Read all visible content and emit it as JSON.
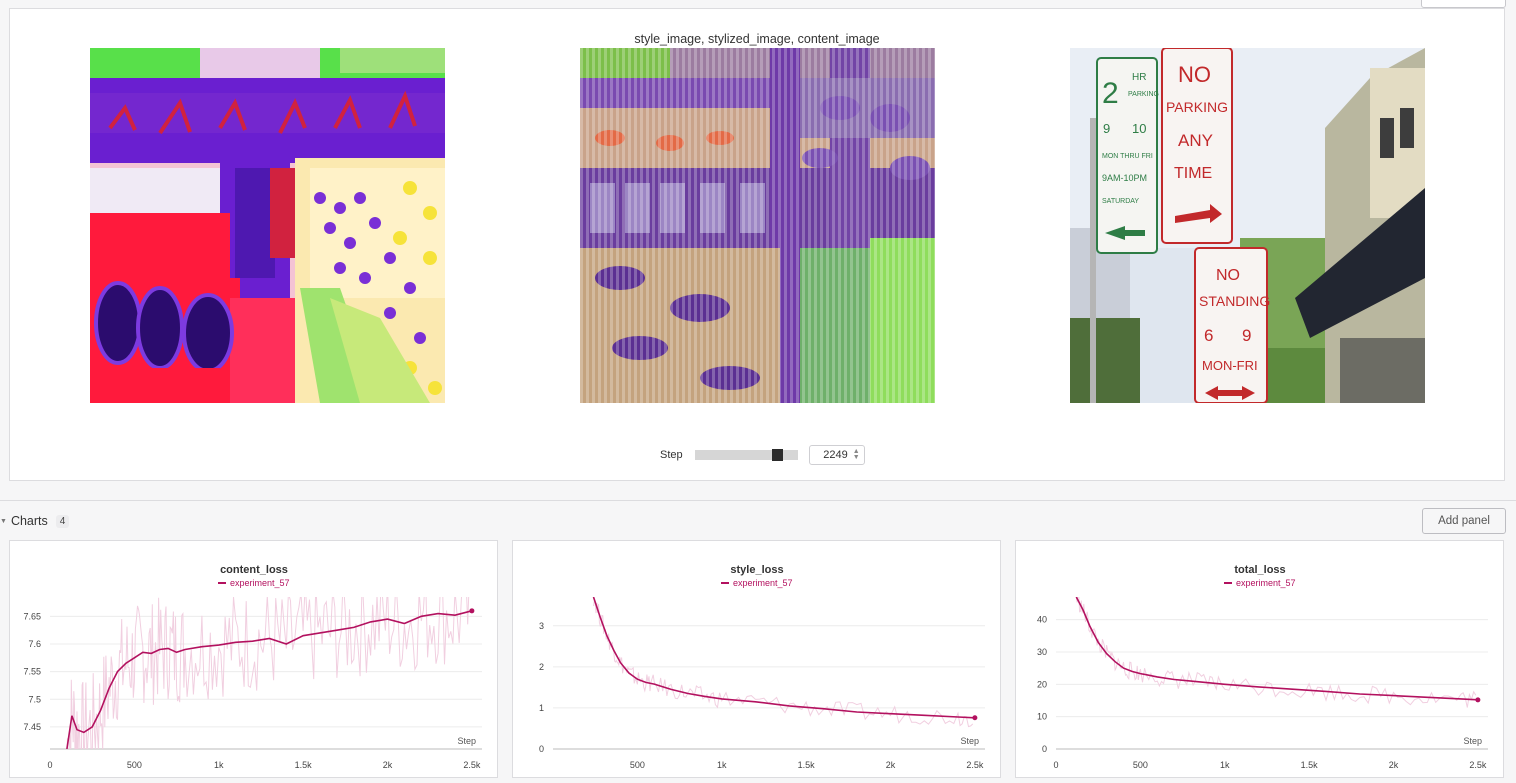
{
  "media": {
    "title": "style_image, stylized_image, content_image",
    "images": [
      {
        "name": "style_image"
      },
      {
        "name": "stylized_image"
      },
      {
        "name": "content_image",
        "sign_texts": [
          "2",
          "HR",
          "PARKING",
          "9",
          "10",
          "MON THRU FRI",
          "9AM-10PM",
          "SATURDAY",
          "NO",
          "PARKING",
          "ANY",
          "TIME",
          "NO",
          "STANDING",
          "6",
          "9",
          "MON-FRI"
        ]
      }
    ],
    "step": {
      "label": "Step",
      "value": "2249",
      "position_fraction": 0.84
    }
  },
  "charts_section": {
    "title": "Charts",
    "count": "4",
    "add_panel_label": "Add panel"
  },
  "colors": {
    "series": "#b3115f",
    "series_light": "#f1cfe0",
    "grid": "#ececec"
  },
  "charts": [
    {
      "title": "content_loss",
      "legend": "experiment_57",
      "xlabel": "Step",
      "xticks": [
        "0",
        "500",
        "1k",
        "1.5k",
        "2k",
        "2.5k"
      ],
      "yticks": [
        "7.45",
        "7.5",
        "7.55",
        "7.6",
        "7.65"
      ],
      "chart_data": {
        "type": "line",
        "series": [
          {
            "name": "experiment_57",
            "x": [
              100,
              130,
              160,
              200,
              250,
              300,
              350,
              400,
              450,
              500,
              550,
              600,
              650,
              700,
              750,
              800,
              900,
              1000,
              1100,
              1200,
              1300,
              1400,
              1500,
              1600,
              1700,
              1800,
              1900,
              2000,
              2100,
              2200,
              2300,
              2400,
              2500
            ],
            "y": [
              7.41,
              7.47,
              7.445,
              7.44,
              7.45,
              7.48,
              7.52,
              7.55,
              7.565,
              7.575,
              7.585,
              7.583,
              7.59,
              7.592,
              7.585,
              7.59,
              7.595,
              7.598,
              7.603,
              7.605,
              7.61,
              7.6,
              7.615,
              7.62,
              7.625,
              7.63,
              7.64,
              7.645,
              7.637,
              7.65,
              7.655,
              7.652,
              7.66
            ]
          }
        ],
        "xlim": [
          0,
          2560
        ],
        "ylim": [
          7.41,
          7.685
        ]
      }
    },
    {
      "title": "style_loss",
      "legend": "experiment_57",
      "xlabel": "Step",
      "xticks": [
        "500",
        "1k",
        "1.5k",
        "2k",
        "2.5k"
      ],
      "yticks": [
        "0",
        "1",
        "2",
        "3"
      ],
      "chart_data": {
        "type": "line",
        "series": [
          {
            "name": "experiment_57",
            "x": [
              240,
              280,
              320,
              360,
              400,
              450,
              500,
              550,
              600,
              700,
              800,
              900,
              1000,
              1200,
              1400,
              1600,
              1800,
              2000,
              2200,
              2400,
              2500
            ],
            "y": [
              3.7,
              3.2,
              2.75,
              2.4,
              2.1,
              1.85,
              1.7,
              1.62,
              1.58,
              1.45,
              1.35,
              1.28,
              1.22,
              1.15,
              1.05,
              0.98,
              0.9,
              0.86,
              0.82,
              0.78,
              0.76
            ]
          }
        ],
        "xlim": [
          0,
          2560
        ],
        "ylim": [
          0,
          3.7
        ]
      }
    },
    {
      "title": "total_loss",
      "legend": "experiment_57",
      "xlabel": "Step",
      "xticks": [
        "0",
        "500",
        "1k",
        "1.5k",
        "2k",
        "2.5k"
      ],
      "yticks": [
        "0",
        "10",
        "20",
        "30",
        "40"
      ],
      "chart_data": {
        "type": "line",
        "series": [
          {
            "name": "experiment_57",
            "x": [
              120,
              160,
              200,
              250,
              300,
              350,
              400,
              450,
              500,
              600,
              700,
              800,
              900,
              1000,
              1200,
              1400,
              1600,
              1800,
              2000,
              2200,
              2400,
              2500
            ],
            "y": [
              47,
              43,
              38,
              33,
              29.5,
              27,
              25,
              24,
              23.3,
              22.3,
              21.5,
              21,
              20.5,
              20,
              19.2,
              18.5,
              17.8,
              17,
              16.5,
              16,
              15.5,
              15.2
            ]
          }
        ],
        "xlim": [
          0,
          2560
        ],
        "ylim": [
          0,
          47
        ]
      }
    }
  ]
}
